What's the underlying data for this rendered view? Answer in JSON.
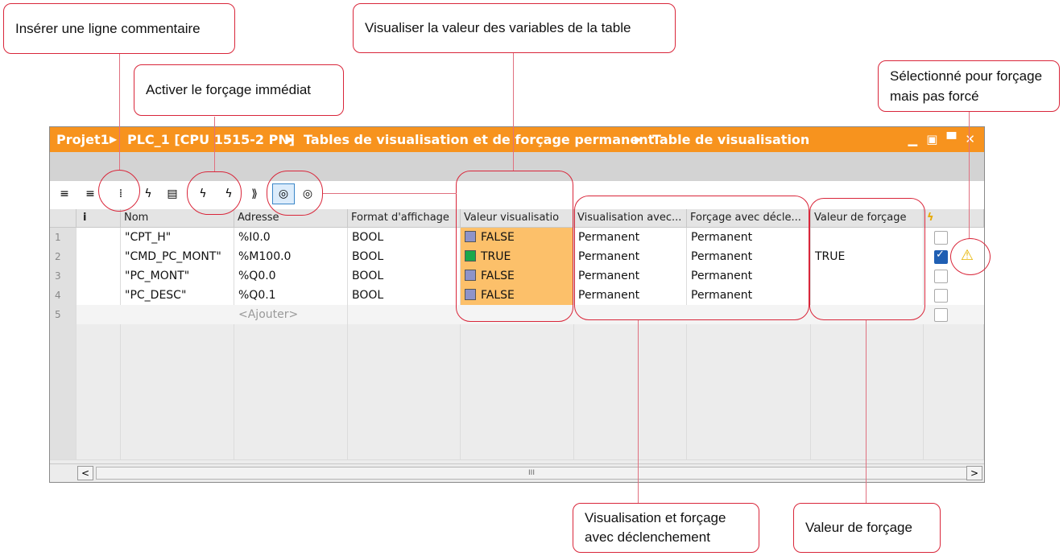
{
  "window": {
    "breadcrumb": [
      "Projet1",
      "PLC_1 [CPU 1515-2 PN]",
      "Tables de visualisation et de forçage permanent",
      "Table de visualisation"
    ],
    "controls": "▁ ▣ ▀ ✕"
  },
  "toolbar": {
    "buttons": [
      {
        "name": "insert-row-icon",
        "glyph": "≡"
      },
      {
        "name": "add-row-icon",
        "glyph": "≡"
      },
      {
        "name": "insert-comment-row-icon",
        "glyph": "⁞"
      },
      {
        "name": "modify-now-icon",
        "glyph": "ϟ"
      },
      {
        "name": "modify-trigger-icon",
        "glyph": "▤"
      },
      {
        "name": "force-now-icon",
        "glyph": "ϟ"
      },
      {
        "name": "force-trigger-icon",
        "glyph": "ϟ"
      },
      {
        "name": "stop-force-icon",
        "glyph": "⟫"
      },
      {
        "name": "monitor-all-icon",
        "glyph": "◎"
      },
      {
        "name": "monitor-once-icon",
        "glyph": "◎"
      }
    ]
  },
  "table": {
    "headers": [
      "",
      "i",
      "Nom",
      "Adresse",
      "Format d'affichage",
      "Valeur visualisatio",
      "Visualisation avec...",
      "Forçage avec décle...",
      "Valeur de forçage",
      "ϟ"
    ],
    "rows": [
      {
        "n": "1",
        "nom": "\"CPT_H\"",
        "adresse": "%I0.0",
        "format": "BOOL",
        "valeur": "FALSE",
        "vis": "Permanent",
        "forc": "Permanent",
        "valforc": "",
        "checked": false
      },
      {
        "n": "2",
        "nom": "\"CMD_PC_MONT\"",
        "adresse": "%M100.0",
        "format": "BOOL",
        "valeur": "TRUE",
        "vis": "Permanent",
        "forc": "Permanent",
        "valforc": "TRUE",
        "checked": true
      },
      {
        "n": "3",
        "nom": "\"PC_MONT\"",
        "adresse": "%Q0.0",
        "format": "BOOL",
        "valeur": "FALSE",
        "vis": "Permanent",
        "forc": "Permanent",
        "valforc": "",
        "checked": false
      },
      {
        "n": "4",
        "nom": "\"PC_DESC\"",
        "adresse": "%Q0.1",
        "format": "BOOL",
        "valeur": "FALSE",
        "vis": "Permanent",
        "forc": "Permanent",
        "valforc": "",
        "checked": false
      }
    ],
    "add_row": {
      "n": "5",
      "placeholder": "<Ajouter>"
    }
  },
  "scrollbar": {
    "left": "<",
    "right": ">",
    "thumb": "III"
  },
  "callouts": {
    "inserer": "Insérer une ligne commentaire",
    "activer": "Activer le forçage immédiat",
    "visualiser": "Visualiser la valeur des variables de la table",
    "selectionne": "Sélectionné pour forçage mais pas forcé",
    "declenchement": "Visualisation et forçage avec déclenchement",
    "valeur": "Valeur de forçage"
  },
  "colors": {
    "title_bar": "#f7931e",
    "monitor_value_cell": "#fcc06a",
    "callout_border": "#d9263a",
    "true_indicator": "#1aa84b",
    "false_indicator": "#8e93c9"
  }
}
